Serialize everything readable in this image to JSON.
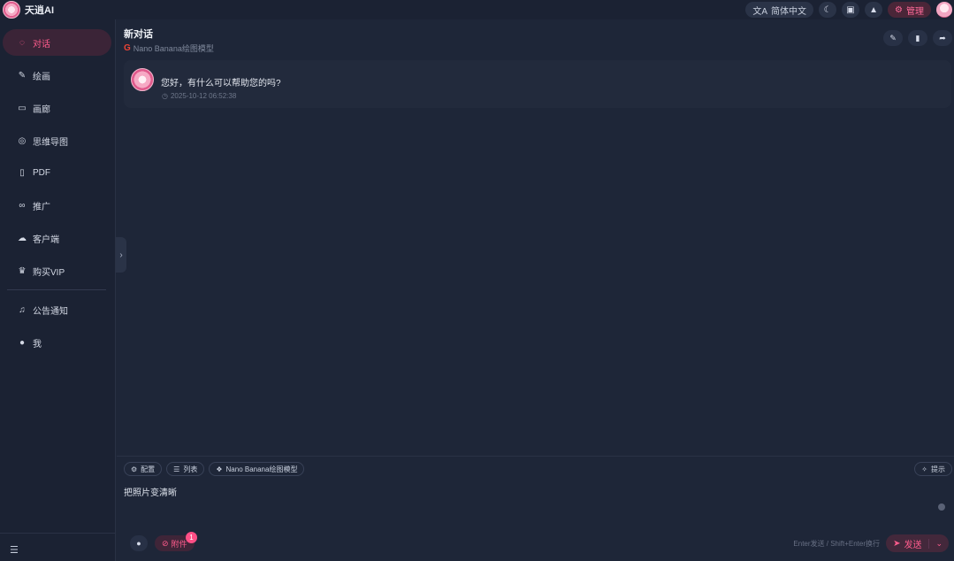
{
  "app": {
    "name": "天逍AI"
  },
  "topbar": {
    "language_label": "简体中文",
    "admin_label": "管理"
  },
  "sidebar": {
    "items": [
      {
        "label": "对话",
        "icon": "chat-icon",
        "active": true
      },
      {
        "label": "绘画",
        "icon": "brush-icon"
      },
      {
        "label": "画廊",
        "icon": "gallery-icon"
      },
      {
        "label": "思维导图",
        "icon": "mindmap-icon"
      },
      {
        "label": "PDF",
        "icon": "pdf-icon"
      },
      {
        "label": "推广",
        "icon": "promote-icon"
      },
      {
        "label": "客户端",
        "icon": "cloud-download-icon"
      },
      {
        "label": "购买VIP",
        "icon": "crown-icon"
      }
    ],
    "secondary_items": [
      {
        "label": "公告通知",
        "icon": "bell-icon"
      },
      {
        "label": "我",
        "icon": "user-icon"
      }
    ]
  },
  "chat": {
    "title": "新对话",
    "model_subtitle": "Nano Banana绘图模型",
    "message": {
      "text": "您好，有什么可以帮助您的吗?",
      "timestamp": "2025-10-12 06:52:38"
    }
  },
  "composer": {
    "chips": [
      "配置",
      "列表",
      "Nano Banana绘图模型"
    ],
    "right_chip": "提示",
    "input_value": "把照片变清晰",
    "attach_label": "附件",
    "attach_count": "1",
    "hint": "Enter发送 / Shift+Enter换行",
    "send_label": "发送"
  },
  "colors": {
    "accent": "#ff5c8d",
    "background": "#1e2638",
    "sidebar": "#1b2233"
  }
}
